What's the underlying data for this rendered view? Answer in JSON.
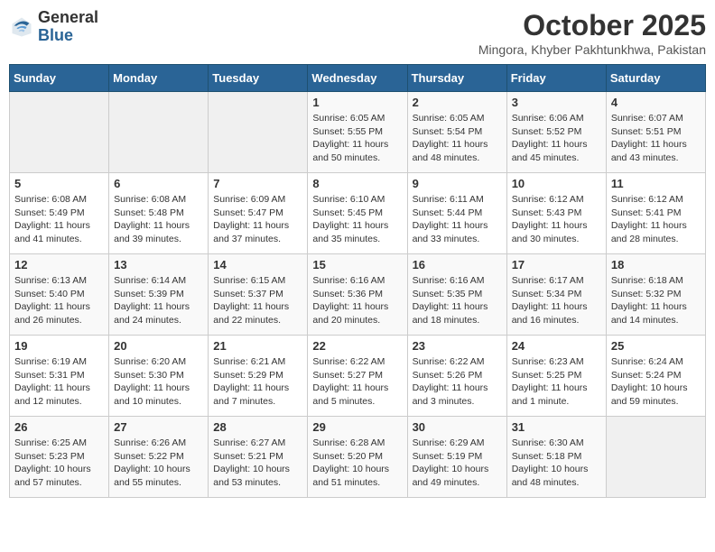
{
  "header": {
    "logo_general": "General",
    "logo_blue": "Blue",
    "month": "October 2025",
    "location": "Mingora, Khyber Pakhtunkhwa, Pakistan"
  },
  "days_of_week": [
    "Sunday",
    "Monday",
    "Tuesday",
    "Wednesday",
    "Thursday",
    "Friday",
    "Saturday"
  ],
  "weeks": [
    [
      {
        "day": "",
        "info": ""
      },
      {
        "day": "",
        "info": ""
      },
      {
        "day": "",
        "info": ""
      },
      {
        "day": "1",
        "info": "Sunrise: 6:05 AM\nSunset: 5:55 PM\nDaylight: 11 hours\nand 50 minutes."
      },
      {
        "day": "2",
        "info": "Sunrise: 6:05 AM\nSunset: 5:54 PM\nDaylight: 11 hours\nand 48 minutes."
      },
      {
        "day": "3",
        "info": "Sunrise: 6:06 AM\nSunset: 5:52 PM\nDaylight: 11 hours\nand 45 minutes."
      },
      {
        "day": "4",
        "info": "Sunrise: 6:07 AM\nSunset: 5:51 PM\nDaylight: 11 hours\nand 43 minutes."
      }
    ],
    [
      {
        "day": "5",
        "info": "Sunrise: 6:08 AM\nSunset: 5:49 PM\nDaylight: 11 hours\nand 41 minutes."
      },
      {
        "day": "6",
        "info": "Sunrise: 6:08 AM\nSunset: 5:48 PM\nDaylight: 11 hours\nand 39 minutes."
      },
      {
        "day": "7",
        "info": "Sunrise: 6:09 AM\nSunset: 5:47 PM\nDaylight: 11 hours\nand 37 minutes."
      },
      {
        "day": "8",
        "info": "Sunrise: 6:10 AM\nSunset: 5:45 PM\nDaylight: 11 hours\nand 35 minutes."
      },
      {
        "day": "9",
        "info": "Sunrise: 6:11 AM\nSunset: 5:44 PM\nDaylight: 11 hours\nand 33 minutes."
      },
      {
        "day": "10",
        "info": "Sunrise: 6:12 AM\nSunset: 5:43 PM\nDaylight: 11 hours\nand 30 minutes."
      },
      {
        "day": "11",
        "info": "Sunrise: 6:12 AM\nSunset: 5:41 PM\nDaylight: 11 hours\nand 28 minutes."
      }
    ],
    [
      {
        "day": "12",
        "info": "Sunrise: 6:13 AM\nSunset: 5:40 PM\nDaylight: 11 hours\nand 26 minutes."
      },
      {
        "day": "13",
        "info": "Sunrise: 6:14 AM\nSunset: 5:39 PM\nDaylight: 11 hours\nand 24 minutes."
      },
      {
        "day": "14",
        "info": "Sunrise: 6:15 AM\nSunset: 5:37 PM\nDaylight: 11 hours\nand 22 minutes."
      },
      {
        "day": "15",
        "info": "Sunrise: 6:16 AM\nSunset: 5:36 PM\nDaylight: 11 hours\nand 20 minutes."
      },
      {
        "day": "16",
        "info": "Sunrise: 6:16 AM\nSunset: 5:35 PM\nDaylight: 11 hours\nand 18 minutes."
      },
      {
        "day": "17",
        "info": "Sunrise: 6:17 AM\nSunset: 5:34 PM\nDaylight: 11 hours\nand 16 minutes."
      },
      {
        "day": "18",
        "info": "Sunrise: 6:18 AM\nSunset: 5:32 PM\nDaylight: 11 hours\nand 14 minutes."
      }
    ],
    [
      {
        "day": "19",
        "info": "Sunrise: 6:19 AM\nSunset: 5:31 PM\nDaylight: 11 hours\nand 12 minutes."
      },
      {
        "day": "20",
        "info": "Sunrise: 6:20 AM\nSunset: 5:30 PM\nDaylight: 11 hours\nand 10 minutes."
      },
      {
        "day": "21",
        "info": "Sunrise: 6:21 AM\nSunset: 5:29 PM\nDaylight: 11 hours\nand 7 minutes."
      },
      {
        "day": "22",
        "info": "Sunrise: 6:22 AM\nSunset: 5:27 PM\nDaylight: 11 hours\nand 5 minutes."
      },
      {
        "day": "23",
        "info": "Sunrise: 6:22 AM\nSunset: 5:26 PM\nDaylight: 11 hours\nand 3 minutes."
      },
      {
        "day": "24",
        "info": "Sunrise: 6:23 AM\nSunset: 5:25 PM\nDaylight: 11 hours\nand 1 minute."
      },
      {
        "day": "25",
        "info": "Sunrise: 6:24 AM\nSunset: 5:24 PM\nDaylight: 10 hours\nand 59 minutes."
      }
    ],
    [
      {
        "day": "26",
        "info": "Sunrise: 6:25 AM\nSunset: 5:23 PM\nDaylight: 10 hours\nand 57 minutes."
      },
      {
        "day": "27",
        "info": "Sunrise: 6:26 AM\nSunset: 5:22 PM\nDaylight: 10 hours\nand 55 minutes."
      },
      {
        "day": "28",
        "info": "Sunrise: 6:27 AM\nSunset: 5:21 PM\nDaylight: 10 hours\nand 53 minutes."
      },
      {
        "day": "29",
        "info": "Sunrise: 6:28 AM\nSunset: 5:20 PM\nDaylight: 10 hours\nand 51 minutes."
      },
      {
        "day": "30",
        "info": "Sunrise: 6:29 AM\nSunset: 5:19 PM\nDaylight: 10 hours\nand 49 minutes."
      },
      {
        "day": "31",
        "info": "Sunrise: 6:30 AM\nSunset: 5:18 PM\nDaylight: 10 hours\nand 48 minutes."
      },
      {
        "day": "",
        "info": ""
      }
    ]
  ]
}
